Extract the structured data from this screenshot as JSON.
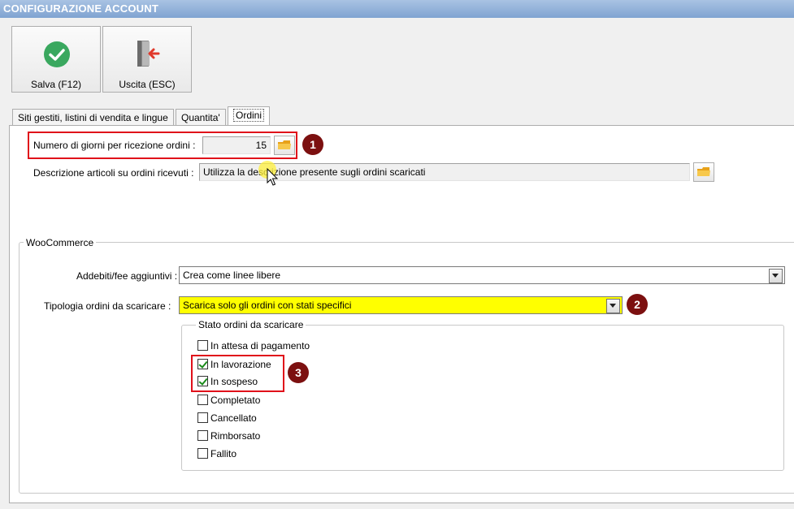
{
  "window": {
    "title": "CONFIGURAZIONE ACCOUNT"
  },
  "toolbar": {
    "save_label": "Salva (F12)",
    "exit_label": "Uscita (ESC)"
  },
  "tabs": [
    {
      "label": "Siti gestiti, listini di vendita e lingue"
    },
    {
      "label": "Quantita'"
    },
    {
      "label": "Ordini"
    }
  ],
  "orders": {
    "days_label": "Numero di giorni per ricezione ordini :",
    "days_value": "15",
    "desc_label": "Descrizione articoli su ordini ricevuti :",
    "desc_value": "Utilizza la descrizione presente sugli ordini scaricati"
  },
  "woocommerce": {
    "title": "WooCommerce",
    "fees_label": "Addebiti/fee aggiuntivi :",
    "fees_value": "Crea come linee libere",
    "type_label": "Tipologia ordini da scaricare :",
    "type_value": "Scarica solo gli ordini con stati specifici",
    "status_group": {
      "title": "Stato ordini da scaricare",
      "items": [
        {
          "label": "In attesa di pagamento",
          "checked": false
        },
        {
          "label": "In lavorazione",
          "checked": true
        },
        {
          "label": "In sospeso",
          "checked": true
        },
        {
          "label": "Completato",
          "checked": false
        },
        {
          "label": "Cancellato",
          "checked": false
        },
        {
          "label": "Rimborsato",
          "checked": false
        },
        {
          "label": "Fallito",
          "checked": false
        }
      ]
    }
  },
  "callouts": [
    "1",
    "2",
    "3"
  ],
  "colors": {
    "highlight": "#ffff00",
    "callout": "#7c1010",
    "annotation_border": "#e0101a"
  }
}
